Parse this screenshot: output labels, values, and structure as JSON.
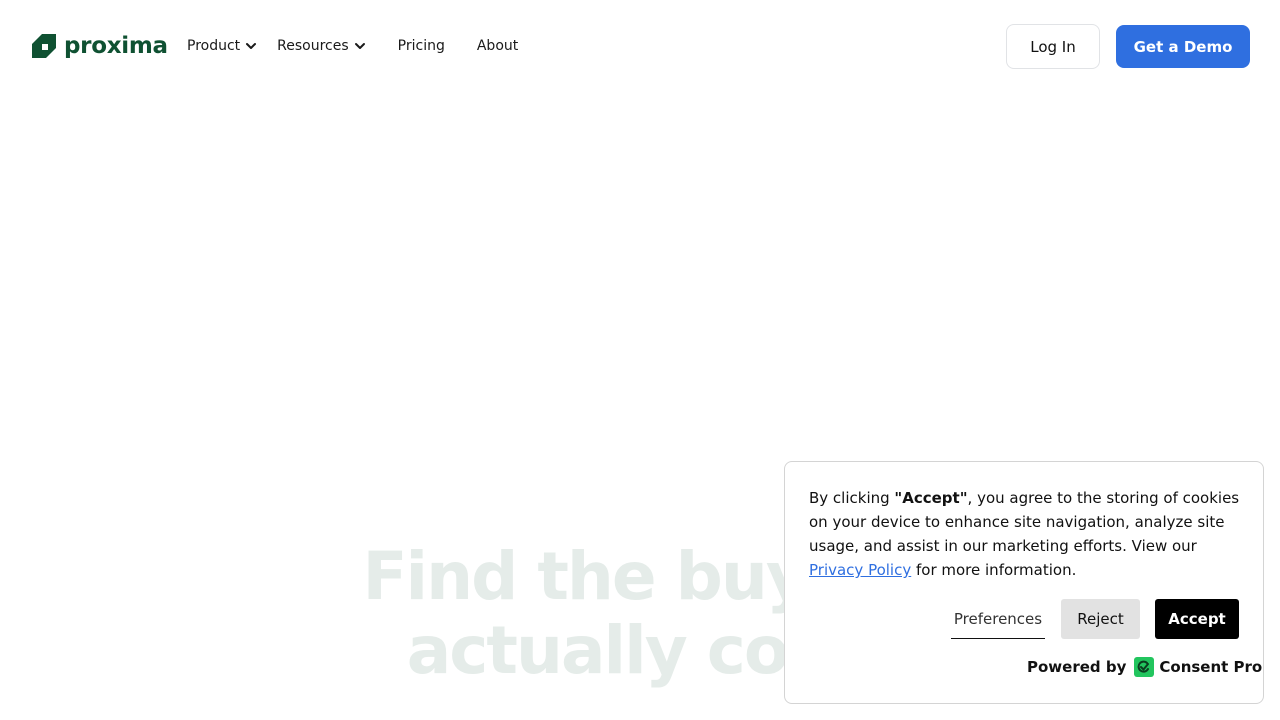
{
  "brand": {
    "name": "proxima",
    "color": "#0f5132"
  },
  "nav": {
    "items": [
      {
        "label": "Product",
        "has_dropdown": true
      },
      {
        "label": "Resources",
        "has_dropdown": true
      },
      {
        "label": "Pricing",
        "has_dropdown": false
      },
      {
        "label": "About",
        "has_dropdown": false
      }
    ]
  },
  "header": {
    "login_label": "Log In",
    "demo_label": "Get a Demo",
    "demo_color": "#2f6fe0"
  },
  "hero": {
    "line1": "Find the buyers",
    "line2": "actually conv"
  },
  "cookie": {
    "text_before": "By clicking ",
    "accept_quote": "\"Accept\"",
    "text_middle": ", you agree to the storing of cookies on your device to enhance site navigation, analyze site usage, and assist in our marketing efforts. View our ",
    "privacy_link": "Privacy Policy",
    "text_after": " for more information.",
    "preferences_label": "Preferences",
    "reject_label": "Reject",
    "accept_label": "Accept",
    "powered_by_label": "Powered by",
    "provider_name": "Consent Pro",
    "provider_color": "#22c55e"
  }
}
